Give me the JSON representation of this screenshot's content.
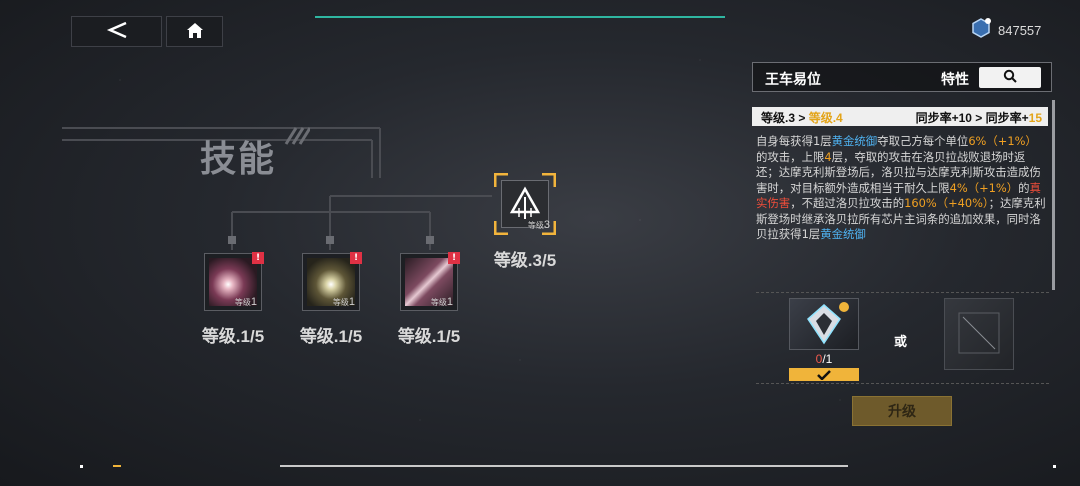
{
  "topbar": {
    "currency_value": "847557"
  },
  "skills": {
    "title": "技能",
    "nodes": [
      {
        "id": "skill-1",
        "tag_prefix": "等级",
        "tag_level": "1",
        "label": "等级.1/5",
        "alert": "!"
      },
      {
        "id": "skill-2",
        "tag_prefix": "等级",
        "tag_level": "1",
        "label": "等级.1/5",
        "alert": "!"
      },
      {
        "id": "skill-3",
        "tag_prefix": "等级",
        "tag_level": "1",
        "label": "等级.1/5",
        "alert": "!"
      },
      {
        "id": "skill-4",
        "tag_prefix": "等级",
        "tag_level": "3",
        "label": "等级.3/5",
        "alert": ""
      }
    ]
  },
  "panel": {
    "name": "王车易位",
    "trait_label": "特性",
    "level_from": "等级.3",
    "level_sep": " > ",
    "level_to": "等级.4",
    "sync_from": "同步率+10",
    "sync_sep": " > ",
    "sync_to_prefix": "同步率+",
    "sync_to_value": "15",
    "desc": {
      "t1": "自身每获得1层",
      "b1": "黄金统御",
      "t2": "夺取己方每个单位",
      "o1": "6%（+1%）",
      "t3": "的攻击，上限",
      "o2": "4",
      "t4": "层，夺取的攻击在洛贝拉战败退场时返还；达摩克利斯登场后，洛贝拉与达摩克利斯攻击造成伤害时，对目标额外造成相当于耐久上限",
      "o3": "4%（+1%）",
      "t5": "的",
      "r1": "真实伤害",
      "t6": "，不超过洛贝拉攻击的",
      "o4": "160%（+40%）",
      "t7": "；达摩克利斯登场时继承洛贝拉所有芯片主词条的追加效果，同时洛贝拉获得1层",
      "b2": "黄金统御"
    },
    "material": {
      "owned": "0",
      "required": "/1"
    },
    "or_label": "或",
    "upgrade_label": "升级"
  },
  "colors": {
    "accent_gold": "#e3a419",
    "highlight_blue": "#4fb3f2",
    "highlight_orange": "#f0a022",
    "highlight_red": "#ef4d3a",
    "alert_red": "#e03144"
  }
}
